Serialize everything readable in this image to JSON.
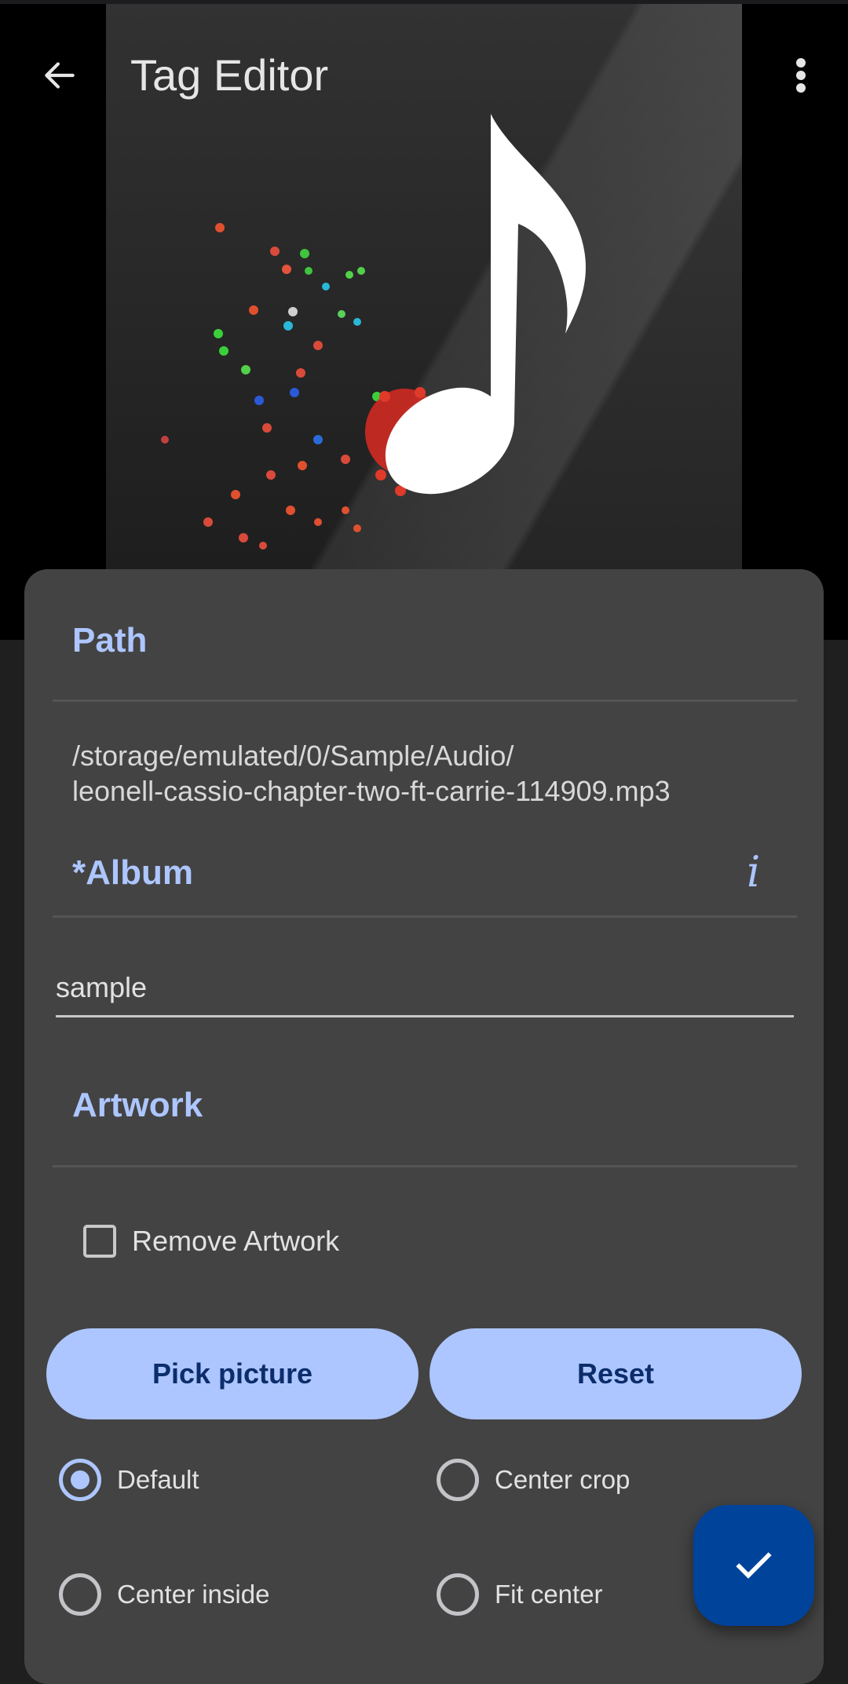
{
  "toolbar": {
    "title": "Tag Editor",
    "back_icon": "arrow-left-icon",
    "menu_icon": "more-vert-icon"
  },
  "artwork_image": {
    "description": "White music note with colorful particle notes scattering to the left on a dark gradient background"
  },
  "sections": {
    "path": {
      "title": "Path",
      "value_line1": "/storage/emulated/0/Sample/Audio/",
      "value_line2": "leonell-cassio-chapter-two-ft-carrie-114909.mp3"
    },
    "album": {
      "title": "*Album",
      "info_icon_glyph": "i",
      "value": "sample",
      "placeholder": ""
    },
    "artwork": {
      "title": "Artwork",
      "remove_checkbox_label": "Remove Artwork",
      "remove_checked": false,
      "pick_button": "Pick picture",
      "reset_button": "Reset",
      "scale_options": [
        {
          "label": "Default",
          "checked": true
        },
        {
          "label": "Center crop",
          "checked": false
        },
        {
          "label": "Center inside",
          "checked": false
        },
        {
          "label": "Fit center",
          "checked": false
        }
      ]
    }
  },
  "fab": {
    "icon": "check-icon"
  },
  "colors": {
    "accent": "#adc6ff",
    "on_accent": "#0b2d6b",
    "card_bg": "#434343",
    "fab_bg": "#00439b",
    "page_bg": "#1f1f1f"
  }
}
